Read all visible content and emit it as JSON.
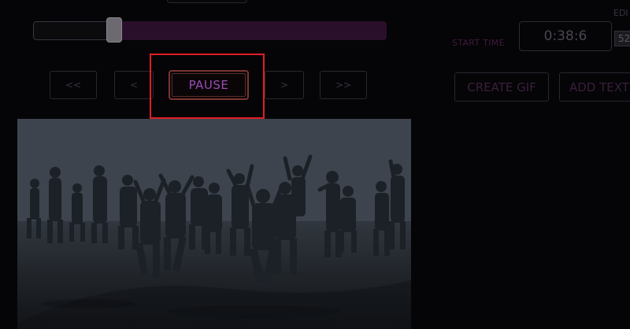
{
  "player": {
    "progress": 0.23,
    "controls": {
      "rewind_fast_label": "<<",
      "rewind_label": "<",
      "pause_label": "PAUSE",
      "forward_label": ">",
      "forward_fast_label": ">>"
    }
  },
  "gif_editor": {
    "start_time_label": "START TIME",
    "start_time_value": "0:38:6",
    "edit_label": "EDI",
    "small_field_value": "52",
    "create_gif_label": "CREATE GIF",
    "add_text_label": "ADD TEXT"
  },
  "colors": {
    "background": "#050406",
    "slider_remaining": "#2a0f2a",
    "pause_text": "#9b4bb5",
    "highlight": "#e01e24"
  }
}
